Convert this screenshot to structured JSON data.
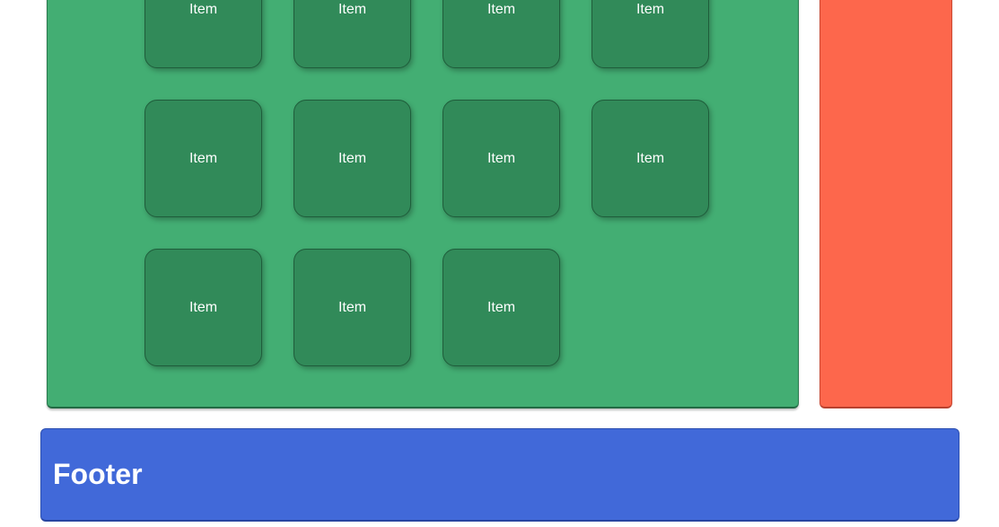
{
  "main": {
    "items": [
      {
        "label": "Item"
      },
      {
        "label": "Item"
      },
      {
        "label": "Item"
      },
      {
        "label": "Item"
      },
      {
        "label": "Item"
      },
      {
        "label": "Item"
      },
      {
        "label": "Item"
      },
      {
        "label": "Item"
      },
      {
        "label": "Item"
      },
      {
        "label": "Item"
      },
      {
        "label": "Item"
      }
    ]
  },
  "footer": {
    "title": "Footer"
  },
  "colors": {
    "main_panel": "#43ae73",
    "item": "#318a59",
    "side_panel": "#fd674c",
    "footer": "#4169d9"
  }
}
